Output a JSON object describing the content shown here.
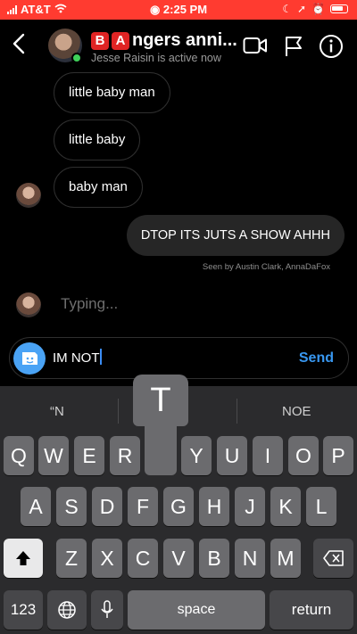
{
  "status_bar": {
    "carrier": "AT&T",
    "time": "2:25 PM",
    "accent_color": "#ff3b30"
  },
  "header": {
    "badge_b": "B",
    "badge_a": "A",
    "title_rest": "ngers anni...",
    "subtitle": "Jesse Raisin is active now",
    "icons": [
      "back-icon",
      "video-call-icon",
      "flag-icon",
      "info-icon"
    ]
  },
  "messages": [
    {
      "text": "little baby man",
      "direction": "incoming"
    },
    {
      "text": "little baby",
      "direction": "incoming"
    },
    {
      "text": "baby man",
      "direction": "incoming"
    },
    {
      "text": "DTOP ITS JUTS A SHOW AHHH",
      "direction": "outgoing"
    }
  ],
  "seen_text": "Seen by Austin Clark, AnnaDaFox",
  "typing_text": "Typing...",
  "composer": {
    "value": "IM NOT",
    "send_label": "Send"
  },
  "keyboard": {
    "suggestions": [
      "“N",
      "",
      "NOE"
    ],
    "popup_key": "T",
    "row1": [
      "Q",
      "W",
      "E",
      "R",
      "T",
      "Y",
      "U",
      "I",
      "O",
      "P"
    ],
    "row2": [
      "A",
      "S",
      "D",
      "F",
      "G",
      "H",
      "J",
      "K",
      "L"
    ],
    "row3": [
      "Z",
      "X",
      "C",
      "V",
      "B",
      "N",
      "M"
    ],
    "numbers_label": "123",
    "space_label": "space",
    "return_label": "return"
  }
}
